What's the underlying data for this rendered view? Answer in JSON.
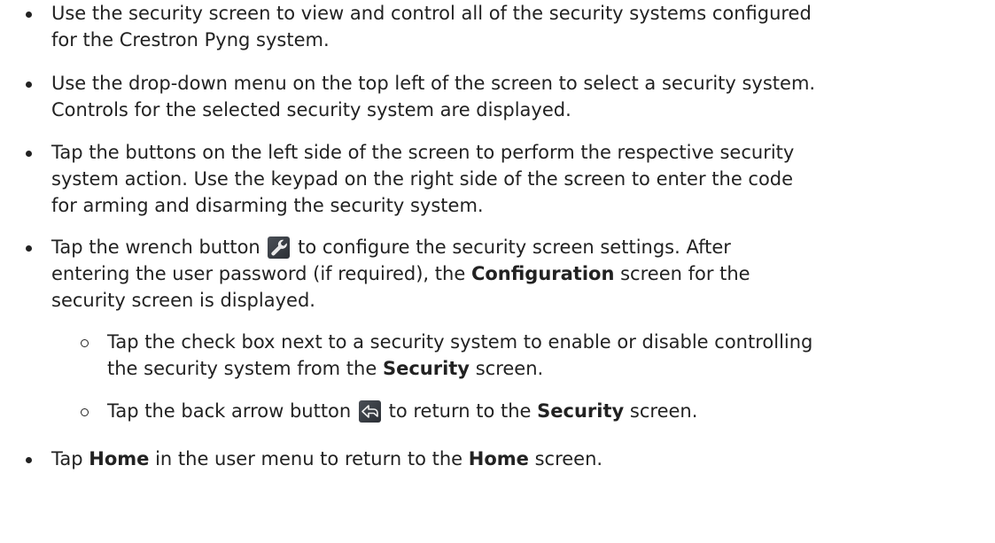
{
  "bullets": [
    {
      "lines": [
        "Use the security screen to view and control all of the security systems configured",
        "for the Crestron Pyng system."
      ]
    },
    {
      "lines": [
        "Use the drop-down menu on the top left of the screen to select a security system.",
        "Controls for the selected security system are displayed."
      ]
    },
    {
      "lines": [
        "Tap the buttons on the left side of the screen to perform the respective security",
        "system action. Use the keypad on the right side of the screen to enter the code",
        "for arming and disarming the security system."
      ]
    },
    {
      "l1_a": "Tap the wrench button",
      "l1_b": "to configure the security screen settings. After",
      "l2_a": "entering the user password (if required), the",
      "l2_bold": "Configuration",
      "l2_b": "screen for the",
      "l3": "security screen is displayed.",
      "icon": "wrench-icon"
    }
  ],
  "sub_bullets": [
    {
      "l1": "Tap the check box next to a security system to enable or disable controlling",
      "l2_a": "the security system from the",
      "l2_bold": "Security",
      "l2_b": "screen."
    },
    {
      "a": "Tap the back arrow button",
      "icon": "back-arrow-icon",
      "b": "to return to the",
      "bold": "Security",
      "c": "screen."
    }
  ],
  "last_bullet": {
    "a": "Tap",
    "bold1": "Home",
    "b": "in the user menu to return to the",
    "bold2": "Home",
    "c": "screen."
  }
}
